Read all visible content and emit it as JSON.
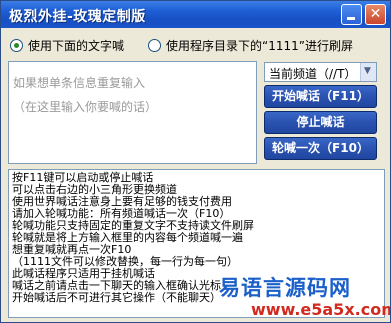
{
  "window": {
    "title": "极烈外挂-玫瑰定制版"
  },
  "icons": {
    "minimize": "minimize-icon",
    "close": "close-icon",
    "dropdown_arrow": "chevron-down-icon"
  },
  "radios": [
    {
      "label": "使用下面的文字喊",
      "checked": true
    },
    {
      "label": "使用程序目录下的“1111”进行刷屏",
      "checked": false
    }
  ],
  "input": {
    "placeholder_lines": [
      "如果想单条信息重复输入",
      "（在这里输入你要喊的话）"
    ]
  },
  "channel_select": {
    "value": "当前频道（//T）"
  },
  "buttons": {
    "start": "开始喊话（F11）",
    "stop": "停止喊话",
    "round": "轮喊一次（F10）"
  },
  "info_lines": [
    "按F11键可以启动或停止喊话",
    "可以点击右边的小三角形更换频道",
    "使用世界喊话注意身上要有足够的钱支付费用",
    "请加入轮喊功能：所有频道喊话一次（F10）",
    "轮喊功能只支持固定的重复文字不支持读文件刷屏",
    "轮喊就是将上方输入框里的内容每个频道喊一遍",
    "想重复喊就再点一次F10",
    "（1111文件可以修改替换，每一行为每一句）",
    "此喊话程序只适用于挂机喊话",
    "喊话之前请点击一下聊天的输入框确认光标",
    "开始喊话后不可进行其它操作（不能聊天）"
  ],
  "watermark": {
    "text": "易语言源码网",
    "url": "www.e5a5x.com"
  },
  "colors": {
    "titlebar": "#1f5fd6",
    "button": "#2a52b0",
    "panel": "#ece9d8",
    "watermark_text": "#1b5fc9",
    "watermark_url": "#d22a1f"
  }
}
